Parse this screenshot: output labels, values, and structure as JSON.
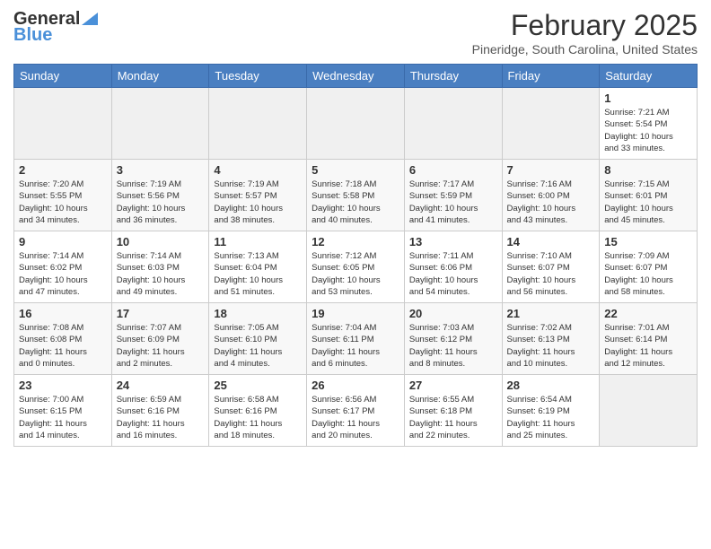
{
  "header": {
    "logo_general": "General",
    "logo_blue": "Blue",
    "month_title": "February 2025",
    "location": "Pineridge, South Carolina, United States"
  },
  "days_of_week": [
    "Sunday",
    "Monday",
    "Tuesday",
    "Wednesday",
    "Thursday",
    "Friday",
    "Saturday"
  ],
  "weeks": [
    [
      {
        "num": "",
        "info": ""
      },
      {
        "num": "",
        "info": ""
      },
      {
        "num": "",
        "info": ""
      },
      {
        "num": "",
        "info": ""
      },
      {
        "num": "",
        "info": ""
      },
      {
        "num": "",
        "info": ""
      },
      {
        "num": "1",
        "info": "Sunrise: 7:21 AM\nSunset: 5:54 PM\nDaylight: 10 hours\nand 33 minutes."
      }
    ],
    [
      {
        "num": "2",
        "info": "Sunrise: 7:20 AM\nSunset: 5:55 PM\nDaylight: 10 hours\nand 34 minutes."
      },
      {
        "num": "3",
        "info": "Sunrise: 7:19 AM\nSunset: 5:56 PM\nDaylight: 10 hours\nand 36 minutes."
      },
      {
        "num": "4",
        "info": "Sunrise: 7:19 AM\nSunset: 5:57 PM\nDaylight: 10 hours\nand 38 minutes."
      },
      {
        "num": "5",
        "info": "Sunrise: 7:18 AM\nSunset: 5:58 PM\nDaylight: 10 hours\nand 40 minutes."
      },
      {
        "num": "6",
        "info": "Sunrise: 7:17 AM\nSunset: 5:59 PM\nDaylight: 10 hours\nand 41 minutes."
      },
      {
        "num": "7",
        "info": "Sunrise: 7:16 AM\nSunset: 6:00 PM\nDaylight: 10 hours\nand 43 minutes."
      },
      {
        "num": "8",
        "info": "Sunrise: 7:15 AM\nSunset: 6:01 PM\nDaylight: 10 hours\nand 45 minutes."
      }
    ],
    [
      {
        "num": "9",
        "info": "Sunrise: 7:14 AM\nSunset: 6:02 PM\nDaylight: 10 hours\nand 47 minutes."
      },
      {
        "num": "10",
        "info": "Sunrise: 7:14 AM\nSunset: 6:03 PM\nDaylight: 10 hours\nand 49 minutes."
      },
      {
        "num": "11",
        "info": "Sunrise: 7:13 AM\nSunset: 6:04 PM\nDaylight: 10 hours\nand 51 minutes."
      },
      {
        "num": "12",
        "info": "Sunrise: 7:12 AM\nSunset: 6:05 PM\nDaylight: 10 hours\nand 53 minutes."
      },
      {
        "num": "13",
        "info": "Sunrise: 7:11 AM\nSunset: 6:06 PM\nDaylight: 10 hours\nand 54 minutes."
      },
      {
        "num": "14",
        "info": "Sunrise: 7:10 AM\nSunset: 6:07 PM\nDaylight: 10 hours\nand 56 minutes."
      },
      {
        "num": "15",
        "info": "Sunrise: 7:09 AM\nSunset: 6:07 PM\nDaylight: 10 hours\nand 58 minutes."
      }
    ],
    [
      {
        "num": "16",
        "info": "Sunrise: 7:08 AM\nSunset: 6:08 PM\nDaylight: 11 hours\nand 0 minutes."
      },
      {
        "num": "17",
        "info": "Sunrise: 7:07 AM\nSunset: 6:09 PM\nDaylight: 11 hours\nand 2 minutes."
      },
      {
        "num": "18",
        "info": "Sunrise: 7:05 AM\nSunset: 6:10 PM\nDaylight: 11 hours\nand 4 minutes."
      },
      {
        "num": "19",
        "info": "Sunrise: 7:04 AM\nSunset: 6:11 PM\nDaylight: 11 hours\nand 6 minutes."
      },
      {
        "num": "20",
        "info": "Sunrise: 7:03 AM\nSunset: 6:12 PM\nDaylight: 11 hours\nand 8 minutes."
      },
      {
        "num": "21",
        "info": "Sunrise: 7:02 AM\nSunset: 6:13 PM\nDaylight: 11 hours\nand 10 minutes."
      },
      {
        "num": "22",
        "info": "Sunrise: 7:01 AM\nSunset: 6:14 PM\nDaylight: 11 hours\nand 12 minutes."
      }
    ],
    [
      {
        "num": "23",
        "info": "Sunrise: 7:00 AM\nSunset: 6:15 PM\nDaylight: 11 hours\nand 14 minutes."
      },
      {
        "num": "24",
        "info": "Sunrise: 6:59 AM\nSunset: 6:16 PM\nDaylight: 11 hours\nand 16 minutes."
      },
      {
        "num": "25",
        "info": "Sunrise: 6:58 AM\nSunset: 6:16 PM\nDaylight: 11 hours\nand 18 minutes."
      },
      {
        "num": "26",
        "info": "Sunrise: 6:56 AM\nSunset: 6:17 PM\nDaylight: 11 hours\nand 20 minutes."
      },
      {
        "num": "27",
        "info": "Sunrise: 6:55 AM\nSunset: 6:18 PM\nDaylight: 11 hours\nand 22 minutes."
      },
      {
        "num": "28",
        "info": "Sunrise: 6:54 AM\nSunset: 6:19 PM\nDaylight: 11 hours\nand 25 minutes."
      },
      {
        "num": "",
        "info": ""
      }
    ]
  ]
}
